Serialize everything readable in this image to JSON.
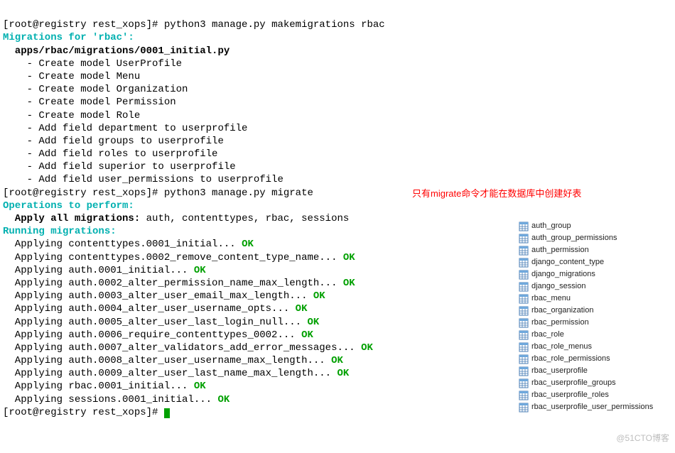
{
  "lines": {
    "prompt1_prefix": "[root@registry rest_xops]# ",
    "cmd1": "python3 manage.py makemigrations rbac",
    "migrations_for": "Migrations for 'rbac':",
    "file_path": "  apps/rbac/migrations/0001_initial.py",
    "create_models": [
      "    - Create model UserProfile",
      "    - Create model Menu",
      "    - Create model Organization",
      "    - Create model Permission",
      "    - Create model Role",
      "    - Add field department to userprofile",
      "    - Add field groups to userprofile",
      "    - Add field roles to userprofile",
      "    - Add field superior to userprofile",
      "    - Add field user_permissions to userprofile"
    ],
    "prompt2_prefix": "[root@registry rest_xops]# ",
    "cmd2": "python3 manage.py migrate",
    "operations": "Operations to perform:",
    "apply_all_label": "  Apply all migrations: ",
    "apply_all_list": "auth, contenttypes, rbac, sessions",
    "running": "Running migrations:",
    "apply_lines": [
      "  Applying contenttypes.0001_initial... ",
      "  Applying contenttypes.0002_remove_content_type_name... ",
      "  Applying auth.0001_initial... ",
      "  Applying auth.0002_alter_permission_name_max_length... ",
      "  Applying auth.0003_alter_user_email_max_length... ",
      "  Applying auth.0004_alter_user_username_opts... ",
      "  Applying auth.0005_alter_user_last_login_null... ",
      "  Applying auth.0006_require_contenttypes_0002... ",
      "  Applying auth.0007_alter_validators_add_error_messages... ",
      "  Applying auth.0008_alter_user_username_max_length... ",
      "  Applying auth.0009_alter_user_last_name_max_length... ",
      "  Applying rbac.0001_initial... ",
      "  Applying sessions.0001_initial... "
    ],
    "ok": "OK",
    "prompt3": "[root@registry rest_xops]# "
  },
  "red_note": "只有migrate命令才能在数据库中创建好表",
  "tables": [
    "auth_group",
    "auth_group_permissions",
    "auth_permission",
    "django_content_type",
    "django_migrations",
    "django_session",
    "rbac_menu",
    "rbac_organization",
    "rbac_permission",
    "rbac_role",
    "rbac_role_menus",
    "rbac_role_permissions",
    "rbac_userprofile",
    "rbac_userprofile_groups",
    "rbac_userprofile_roles",
    "rbac_userprofile_user_permissions"
  ],
  "watermark": "@51CTO博客"
}
